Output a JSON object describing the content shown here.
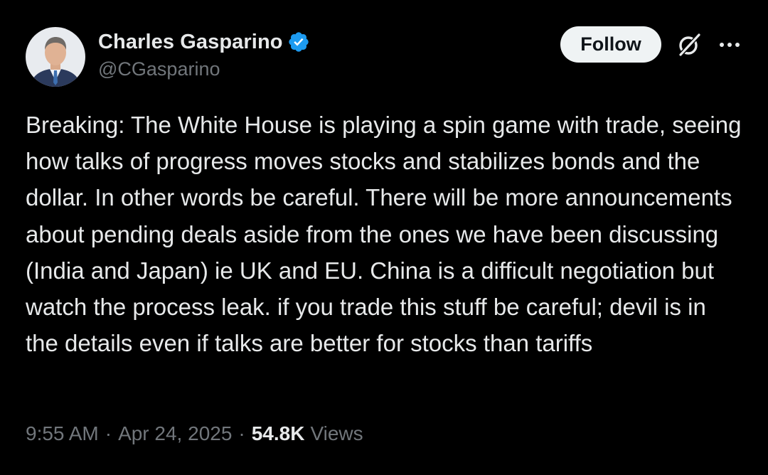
{
  "author": {
    "display_name": "Charles Gasparino",
    "handle": "@CGasparino",
    "verified": true,
    "avatar_icon": "profile-photo"
  },
  "actions": {
    "follow_label": "Follow",
    "grok_icon": "grok-icon",
    "more_icon": "more-icon"
  },
  "tweet": {
    "text": "Breaking: The White House is playing a spin game with trade, seeing how talks of progress moves stocks and stabilizes bonds and the dollar. In other words be careful. There will be more announcements about pending deals aside from the ones we have been discussing (India and Japan) ie UK and EU. China is a difficult negotiation but watch the process leak. if you trade this stuff be careful; devil is in the details even if talks are better for stocks than tariffs"
  },
  "meta": {
    "time": "9:55 AM",
    "separator": "·",
    "date": "Apr 24, 2025",
    "views_count": "54.8K",
    "views_label": "Views"
  },
  "colors": {
    "background": "#000000",
    "text_primary": "#e7e9ea",
    "text_secondary": "#71767b",
    "verified_blue": "#1d9bf0",
    "follow_bg": "#eff3f4"
  }
}
